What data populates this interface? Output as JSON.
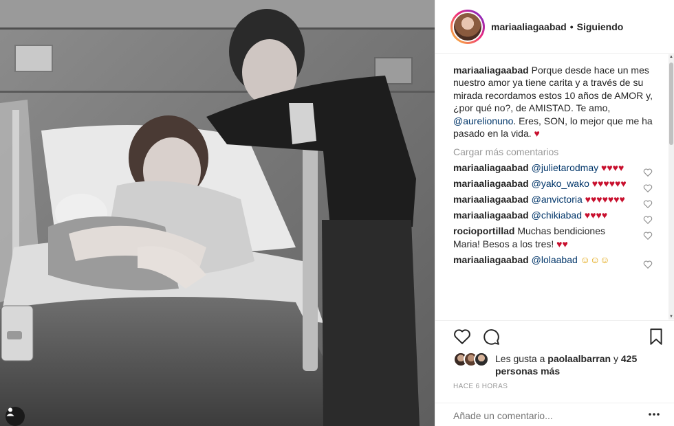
{
  "post": {
    "username": "mariaaliagaabad",
    "separator": "•",
    "follow_status": "Siguiendo"
  },
  "caption": {
    "username": "mariaaliagaabad",
    "text_before_mention": " Porque desde hace un mes nuestro amor ya tiene carita y a través de su mirada recordamos estos 10 años de AMOR y, ¿por qué no?, de AMISTAD. Te amo, ",
    "mention": "@aurelionuno",
    "text_after_mention": ". Eres, SON, lo mejor que me ha pasado en la vida. ",
    "emoji": "♥"
  },
  "load_more_comments": "Cargar más comentarios",
  "comments": [
    {
      "username": "mariaaliagaabad",
      "mention": "@julietarodmay",
      "text": "",
      "emoji": "♥♥♥♥"
    },
    {
      "username": "mariaaliagaabad",
      "mention": "@yako_wako",
      "text": "",
      "emoji": "♥♥♥♥♥♥"
    },
    {
      "username": "mariaaliagaabad",
      "mention": "@anvictoria",
      "text": "",
      "emoji": "♥♥♥♥♥♥♥"
    },
    {
      "username": "mariaaliagaabad",
      "mention": "@chikiabad",
      "text": "",
      "emoji": "♥♥♥♥"
    },
    {
      "username": "rocioportillad",
      "mention": "",
      "text": " Muchas bendiciones Maria! Besos a los tres! ",
      "emoji": "♥♥"
    },
    {
      "username": "mariaaliagaabad",
      "mention": "@lolaabad",
      "text": "",
      "emoji": "☺☺☺"
    }
  ],
  "likes": {
    "prefix": "Les gusta a ",
    "user": "paolaalbarran",
    "suffix": " y ",
    "count_text": "425 personas más"
  },
  "timestamp": "HACE 6 HORAS",
  "add_comment": {
    "placeholder": "Añade un comentario..."
  },
  "icons": {
    "like": "heart-outline-icon",
    "comment": "speech-bubble-icon",
    "save": "bookmark-icon",
    "more": "ellipsis-icon",
    "user_tag": "person-icon"
  },
  "colors": {
    "text": "#262626",
    "muted": "#999999",
    "mention": "#003569",
    "heart_emoji": "#c8102e",
    "border": "#efefef"
  }
}
